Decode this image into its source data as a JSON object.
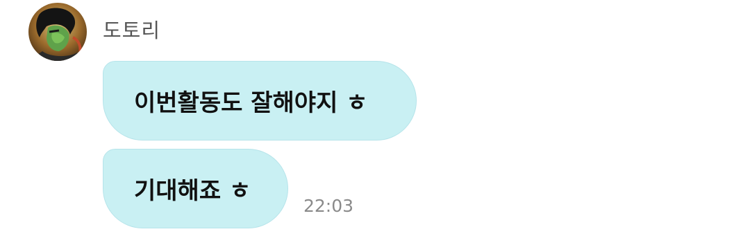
{
  "sender": {
    "name": "도토리",
    "avatar_icon": "profile-photo"
  },
  "messages": [
    {
      "text": "이번활동도 잘해야지 ㅎ"
    },
    {
      "text": "기대해죠 ㅎ"
    }
  ],
  "timestamp": "22:03",
  "colors": {
    "bubble": "#c9f0f3",
    "bubble_border": "#b6e4ea",
    "sender_text": "#555555",
    "timestamp_text": "#8a8a8a",
    "background": "#ffffff"
  }
}
